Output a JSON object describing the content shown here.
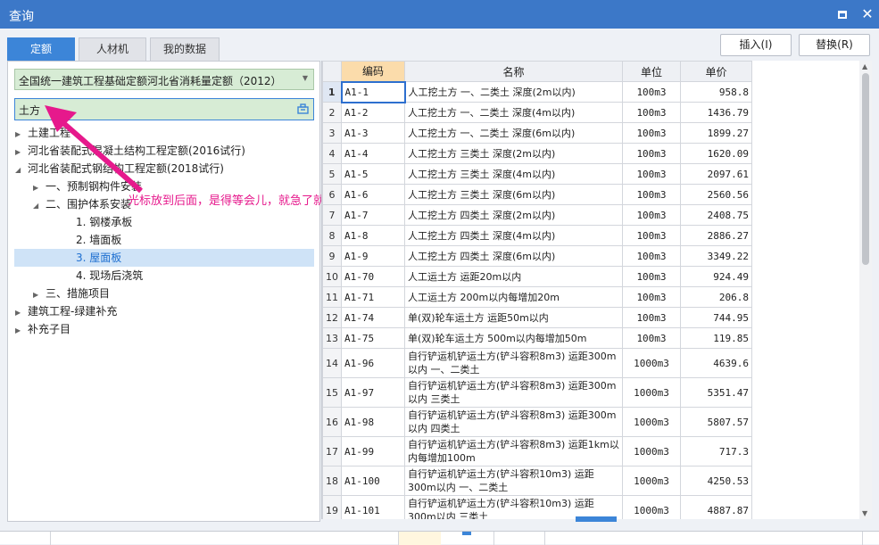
{
  "window": {
    "title": "查询"
  },
  "tabs": [
    "定额",
    "人材机",
    "我的数据"
  ],
  "actions": {
    "insert": "插入(I)",
    "replace": "替换(R)"
  },
  "library_select": "全国统一建筑工程基础定额河北省消耗量定额（2012）",
  "search": {
    "value": "土方"
  },
  "tree": [
    {
      "label": "土建工程",
      "arrow": "right"
    },
    {
      "label": "河北省装配式混凝土结构工程定额(2016试行)",
      "arrow": "right"
    },
    {
      "label": "河北省装配式钢结构工程定额(2018试行)",
      "arrow": "down"
    },
    {
      "label": "一、预制钢构件安装",
      "arrow": "right"
    },
    {
      "label": "二、围护体系安装",
      "arrow": "down"
    },
    {
      "label": "1. 钢楼承板",
      "arrow": ""
    },
    {
      "label": "2. 墙面板",
      "arrow": ""
    },
    {
      "label": "3. 屋面板",
      "arrow": "",
      "selected": true
    },
    {
      "label": "4. 现场后浇筑",
      "arrow": ""
    },
    {
      "label": "三、措施项目",
      "arrow": "right"
    },
    {
      "label": "建筑工程-绿建补充",
      "arrow": "right"
    },
    {
      "label": "补充子目",
      "arrow": "right"
    }
  ],
  "annotation": "光标放到后面，是得等会儿，就急了就好",
  "grid": {
    "headers": [
      "编码",
      "名称",
      "单位",
      "单价"
    ],
    "rows": [
      {
        "n": "1",
        "code": "A1-1",
        "name": "人工挖土方 一、二类土 深度(2m以内)",
        "unit": "100m3",
        "price": "958.8"
      },
      {
        "n": "2",
        "code": "A1-2",
        "name": "人工挖土方 一、二类土 深度(4m以内)",
        "unit": "100m3",
        "price": "1436.79"
      },
      {
        "n": "3",
        "code": "A1-3",
        "name": "人工挖土方 一、二类土 深度(6m以内)",
        "unit": "100m3",
        "price": "1899.27"
      },
      {
        "n": "4",
        "code": "A1-4",
        "name": "人工挖土方 三类土 深度(2m以内)",
        "unit": "100m3",
        "price": "1620.09"
      },
      {
        "n": "5",
        "code": "A1-5",
        "name": "人工挖土方 三类土 深度(4m以内)",
        "unit": "100m3",
        "price": "2097.61"
      },
      {
        "n": "6",
        "code": "A1-6",
        "name": "人工挖土方 三类土 深度(6m以内)",
        "unit": "100m3",
        "price": "2560.56"
      },
      {
        "n": "7",
        "code": "A1-7",
        "name": "人工挖土方 四类土 深度(2m以内)",
        "unit": "100m3",
        "price": "2408.75"
      },
      {
        "n": "8",
        "code": "A1-8",
        "name": "人工挖土方 四类土 深度(4m以内)",
        "unit": "100m3",
        "price": "2886.27"
      },
      {
        "n": "9",
        "code": "A1-9",
        "name": "人工挖土方 四类土 深度(6m以内)",
        "unit": "100m3",
        "price": "3349.22"
      },
      {
        "n": "10",
        "code": "A1-70",
        "name": "人工运土方 运距20m以内",
        "unit": "100m3",
        "price": "924.49"
      },
      {
        "n": "11",
        "code": "A1-71",
        "name": "人工运土方 200m以内每增加20m",
        "unit": "100m3",
        "price": "206.8"
      },
      {
        "n": "12",
        "code": "A1-74",
        "name": "单(双)轮车运土方 运距50m以内",
        "unit": "100m3",
        "price": "744.95"
      },
      {
        "n": "13",
        "code": "A1-75",
        "name": "单(双)轮车运土方 500m以内每增加50m",
        "unit": "100m3",
        "price": "119.85"
      },
      {
        "n": "14",
        "code": "A1-96",
        "name": "自行铲运机铲运土方(铲斗容积8m3) 运距300m以内 一、二类土",
        "unit": "1000m3",
        "price": "4639.6"
      },
      {
        "n": "15",
        "code": "A1-97",
        "name": "自行铲运机铲运土方(铲斗容积8m3) 运距300m以内 三类土",
        "unit": "1000m3",
        "price": "5351.47"
      },
      {
        "n": "16",
        "code": "A1-98",
        "name": "自行铲运机铲运土方(铲斗容积8m3) 运距300m以内 四类土",
        "unit": "1000m3",
        "price": "5807.57"
      },
      {
        "n": "17",
        "code": "A1-99",
        "name": "自行铲运机铲运土方(铲斗容积8m3) 运距1km以内每增加100m",
        "unit": "1000m3",
        "price": "717.3"
      },
      {
        "n": "18",
        "code": "A1-100",
        "name": "自行铲运机铲运土方(铲斗容积10m3) 运距300m以内 一、二类土",
        "unit": "1000m3",
        "price": "4250.53"
      },
      {
        "n": "19",
        "code": "A1-101",
        "name": "自行铲运机铲运土方(铲斗容积10m3) 运距300m以内 三类土",
        "unit": "1000m3",
        "price": "4887.87"
      }
    ]
  }
}
